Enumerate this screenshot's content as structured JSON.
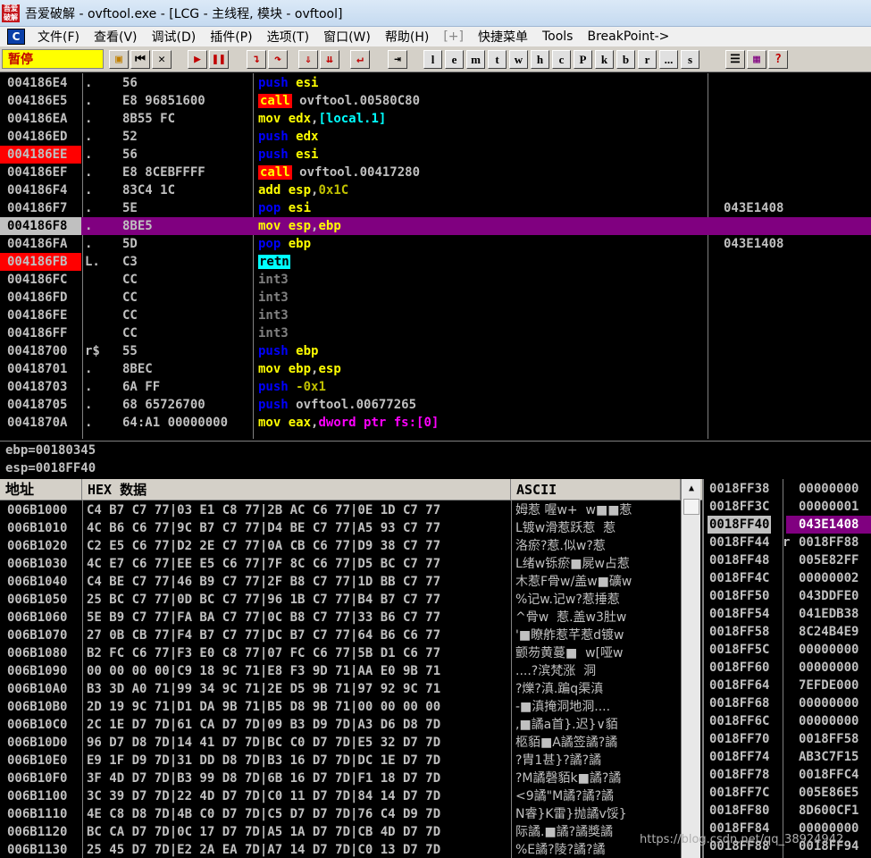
{
  "window": {
    "app_icon_text": "吾爱破解",
    "title": "吾爱破解 - ovftool.exe - [LCG - 主线程, 模块 - ovftool]"
  },
  "menu": {
    "logo": "C",
    "items": [
      "文件(F)",
      "查看(V)",
      "调试(D)",
      "插件(P)",
      "选项(T)",
      "窗口(W)",
      "帮助(H)",
      "[+]",
      "快捷菜单",
      "Tools",
      "BreakPoint->"
    ]
  },
  "toolbar": {
    "status": "暂停",
    "letters": [
      "l",
      "e",
      "m",
      "t",
      "w",
      "h",
      "c",
      "P",
      "k",
      "b",
      "r",
      "...",
      "s"
    ]
  },
  "disasm": {
    "rows": [
      {
        "addr": "004186E4",
        "br": ".",
        "hex": "56",
        "kw": "push",
        "kwc": "k-blue",
        "ops": [
          {
            "t": "esi",
            "c": "op-yellow"
          }
        ],
        "cmt": "",
        "bp": false,
        "sel": false,
        "hl": false
      },
      {
        "addr": "004186E5",
        "br": ".",
        "hex": "E8 96851600",
        "kw": "call",
        "kwc": "k-call",
        "ops": [
          {
            "t": "ovftool.00580C80",
            "c": ""
          }
        ],
        "cmt": "",
        "bp": false,
        "sel": false,
        "hl": false
      },
      {
        "addr": "004186EA",
        "br": ".",
        "hex": "8B55 FC",
        "kw": "mov",
        "kwc": "k-yellow",
        "ops": [
          {
            "t": "edx",
            "c": "op-yellow"
          },
          {
            "t": ",",
            "c": ""
          },
          {
            "t": "[local.1]",
            "c": "op-cyan"
          }
        ],
        "cmt": "",
        "bp": false,
        "sel": false,
        "hl": false
      },
      {
        "addr": "004186ED",
        "br": ".",
        "hex": "52",
        "kw": "push",
        "kwc": "k-blue",
        "ops": [
          {
            "t": "edx",
            "c": "op-yellow"
          }
        ],
        "cmt": "",
        "bp": false,
        "sel": false,
        "hl": false
      },
      {
        "addr": "004186EE",
        "br": ".",
        "hex": "56",
        "kw": "push",
        "kwc": "k-blue",
        "ops": [
          {
            "t": "esi",
            "c": "op-yellow"
          }
        ],
        "cmt": "",
        "bp": true,
        "sel": false,
        "hl": false
      },
      {
        "addr": "004186EF",
        "br": ".",
        "hex": "E8 8CEBFFFF",
        "kw": "call",
        "kwc": "k-call",
        "ops": [
          {
            "t": "ovftool.00417280",
            "c": ""
          }
        ],
        "cmt": "",
        "bp": false,
        "sel": false,
        "hl": false
      },
      {
        "addr": "004186F4",
        "br": ".",
        "hex": "83C4 1C",
        "kw": "add",
        "kwc": "k-yellow",
        "ops": [
          {
            "t": "esp",
            "c": "op-yellow"
          },
          {
            "t": ",",
            "c": ""
          },
          {
            "t": "0x1C",
            "c": "op-olive"
          }
        ],
        "cmt": "",
        "bp": false,
        "sel": false,
        "hl": false
      },
      {
        "addr": "004186F7",
        "br": ".",
        "hex": "5E",
        "kw": "pop",
        "kwc": "k-blue",
        "ops": [
          {
            "t": "esi",
            "c": "op-yellow"
          }
        ],
        "cmt": "043E1408",
        "bp": false,
        "sel": false,
        "hl": false
      },
      {
        "addr": "004186F8",
        "br": ".",
        "hex": "8BE5",
        "kw": "mov",
        "kwc": "k-yellow",
        "ops": [
          {
            "t": "esp",
            "c": "op-yellow"
          },
          {
            "t": ",",
            "c": ""
          },
          {
            "t": "ebp",
            "c": "op-yellow"
          }
        ],
        "cmt": "",
        "bp": false,
        "sel": true,
        "hl": true
      },
      {
        "addr": "004186FA",
        "br": ".",
        "hex": "5D",
        "kw": "pop",
        "kwc": "k-blue",
        "ops": [
          {
            "t": "ebp",
            "c": "op-yellow"
          }
        ],
        "cmt": "043E1408",
        "bp": false,
        "sel": false,
        "hl": false
      },
      {
        "addr": "004186FB",
        "br": "L.",
        "hex": "C3",
        "kw": "retn",
        "kwc": "k-ret",
        "ops": [],
        "cmt": "",
        "bp": true,
        "sel": false,
        "hl": false
      },
      {
        "addr": "004186FC",
        "br": "",
        "hex": "CC",
        "kw": "int3",
        "kwc": "k-grey",
        "ops": [],
        "cmt": "",
        "bp": false,
        "sel": false,
        "hl": false
      },
      {
        "addr": "004186FD",
        "br": "",
        "hex": "CC",
        "kw": "int3",
        "kwc": "k-grey",
        "ops": [],
        "cmt": "",
        "bp": false,
        "sel": false,
        "hl": false
      },
      {
        "addr": "004186FE",
        "br": "",
        "hex": "CC",
        "kw": "int3",
        "kwc": "k-grey",
        "ops": [],
        "cmt": "",
        "bp": false,
        "sel": false,
        "hl": false
      },
      {
        "addr": "004186FF",
        "br": "",
        "hex": "CC",
        "kw": "int3",
        "kwc": "k-grey",
        "ops": [],
        "cmt": "",
        "bp": false,
        "sel": false,
        "hl": false
      },
      {
        "addr": "00418700",
        "br": "r$",
        "hex": "55",
        "kw": "push",
        "kwc": "k-blue",
        "ops": [
          {
            "t": "ebp",
            "c": "op-yellow"
          }
        ],
        "cmt": "",
        "bp": false,
        "sel": false,
        "hl": false
      },
      {
        "addr": "00418701",
        "br": ".",
        "hex": "8BEC",
        "kw": "mov",
        "kwc": "k-yellow",
        "ops": [
          {
            "t": "ebp",
            "c": "op-yellow"
          },
          {
            "t": ",",
            "c": ""
          },
          {
            "t": "esp",
            "c": "op-yellow"
          }
        ],
        "cmt": "",
        "bp": false,
        "sel": false,
        "hl": false
      },
      {
        "addr": "00418703",
        "br": ".",
        "hex": "6A FF",
        "kw": "push",
        "kwc": "k-blue",
        "ops": [
          {
            "t": "-0x1",
            "c": "op-olive"
          }
        ],
        "cmt": "",
        "bp": false,
        "sel": false,
        "hl": false
      },
      {
        "addr": "00418705",
        "br": ".",
        "hex": "68 65726700",
        "kw": "push",
        "kwc": "k-blue",
        "ops": [
          {
            "t": "ovftool.00677265",
            "c": ""
          }
        ],
        "cmt": "",
        "bp": false,
        "sel": false,
        "hl": false
      },
      {
        "addr": "0041870A",
        "br": ".",
        "hex": "64:A1 00000000",
        "kw": "mov",
        "kwc": "k-yellow",
        "ops": [
          {
            "t": "eax",
            "c": "op-yellow"
          },
          {
            "t": ",",
            "c": ""
          },
          {
            "t": "dword ptr fs:[0]",
            "c": "op-mag"
          }
        ],
        "cmt": "",
        "bp": false,
        "sel": false,
        "hl": false
      }
    ]
  },
  "info": {
    "line1": "ebp=00180345",
    "line2": "esp=0018FF40"
  },
  "dump": {
    "header_addr": "地址",
    "header_hex": "HEX 数据",
    "header_ascii": "ASCII",
    "rows": [
      {
        "addr": "006B1000",
        "hex": "C4 B7 C7 77|03 E1 C8 77|2B AC C6 77|0E 1D C7 77",
        "asc": "姆惹 喔w+  w■■惹"
      },
      {
        "addr": "006B1010",
        "hex": "4C B6 C6 77|9C B7 C7 77|D4 BE C7 77|A5 93 C7 77",
        "asc": "L镀w滑惹跃惹  惹"
      },
      {
        "addr": "006B1020",
        "hex": "C2 E5 C6 77|D2 2E C7 77|0A CB C6 77|D9 38 C7 77",
        "asc": "洛瘀?惹.似w?惹"
      },
      {
        "addr": "006B1030",
        "hex": "4C E7 C6 77|EE E5 C6 77|7F 8C C6 77|D5 BC C7 77",
        "asc": "L绪w铄瘀■屍w占惹"
      },
      {
        "addr": "006B1040",
        "hex": "C4 BE C7 77|46 B9 C7 77|2F B8 C7 77|1D BB C7 77",
        "asc": "木惹F骨w/盖w■礦w"
      },
      {
        "addr": "006B1050",
        "hex": "25 BC C7 77|0D BC C7 77|96 1B C7 77|B4 B7 C7 77",
        "asc": "%记w.记w?惹捶惹"
      },
      {
        "addr": "006B1060",
        "hex": "5E B9 C7 77|FA BA C7 77|0C B8 C7 77|33 B6 C7 77",
        "asc": "^骨w  惹.盖w3肚w"
      },
      {
        "addr": "006B1070",
        "hex": "27 0B CB 77|F4 B7 C7 77|DC B7 C7 77|64 B6 C6 77",
        "asc": "'■瞭舴惹芊惹d镀w"
      },
      {
        "addr": "006B1080",
        "hex": "B2 FC C6 77|F3 E0 C8 77|07 FC C6 77|5B D1 C6 77",
        "asc": "颤芴黄蔓■  w[哑w"
      },
      {
        "addr": "006B1090",
        "hex": "00 00 00 00|C9 18 9C 71|E8 F3 9D 71|AA E0 9B 71",
        "asc": "....?滨梵涨  洞"
      },
      {
        "addr": "006B10A0",
        "hex": "B3 3D A0 71|99 34 9C 71|2E D5 9B 71|97 92 9C 71",
        "asc": "?爍?滇.蹁q渠滇"
      },
      {
        "addr": "006B10B0",
        "hex": "2D 19 9C 71|D1 DA 9B 71|B5 D8 9B 71|00 00 00 00",
        "asc": "-■滇掩洞地洞...."
      },
      {
        "addr": "006B10C0",
        "hex": "2C 1E D7 7D|61 CA D7 7D|09 B3 D9 7D|A3 D6 D8 7D",
        "asc": ",■譎a首}.迟}∨貊"
      },
      {
        "addr": "006B10D0",
        "hex": "96 D7 D8 7D|14 41 D7 7D|BC C0 D7 7D|E5 32 D7 7D",
        "asc": "柩貊■A譎签譎?譎"
      },
      {
        "addr": "006B10E0",
        "hex": "E9 1F D9 7D|31 DD D8 7D|B3 16 D7 7D|DC 1E D7 7D",
        "asc": "?胄1甚}?譎?譎"
      },
      {
        "addr": "006B10F0",
        "hex": "3F 4D D7 7D|B3 99 D8 7D|6B 16 D7 7D|F1 18 D7 7D",
        "asc": "?M譎磬貊k■譎?譎"
      },
      {
        "addr": "006B1100",
        "hex": "3C 39 D7 7D|22 4D D7 7D|C0 11 D7 7D|84 14 D7 7D",
        "asc": "<9譎\"M譎?譎?譎"
      },
      {
        "addr": "006B1110",
        "hex": "4E C8 D8 7D|4B C0 D7 7D|C5 D7 D7 7D|76 C4 D9 7D",
        "asc": "N睿}K雷}抛譎v馁}"
      },
      {
        "addr": "006B1120",
        "hex": "BC CA D7 7D|0C 17 D7 7D|A5 1A D7 7D|CB 4D D7 7D",
        "asc": "际譎.■譎?譎獎譎"
      },
      {
        "addr": "006B1130",
        "hex": "25 45 D7 7D|E2 2A EA 7D|A7 14 D7 7D|C0 13 D7 7D",
        "asc": "%E譎?陵?譎?譎"
      }
    ]
  },
  "stack": {
    "rows": [
      {
        "addr": "0018FF38",
        "br": "",
        "val": "00000000",
        "sel": false
      },
      {
        "addr": "0018FF3C",
        "br": "",
        "val": "00000001",
        "sel": false
      },
      {
        "addr": "0018FF40",
        "br": "",
        "val": "043E1408",
        "sel": true
      },
      {
        "addr": "0018FF44",
        "br": "r",
        "val": "0018FF88",
        "sel": false
      },
      {
        "addr": "0018FF48",
        "br": "",
        "val": "005E82FF",
        "sel": false
      },
      {
        "addr": "0018FF4C",
        "br": "",
        "val": "00000002",
        "sel": false
      },
      {
        "addr": "0018FF50",
        "br": "",
        "val": "043DDFE0",
        "sel": false
      },
      {
        "addr": "0018FF54",
        "br": "",
        "val": "041EDB38",
        "sel": false
      },
      {
        "addr": "0018FF58",
        "br": "",
        "val": "8C24B4E9",
        "sel": false
      },
      {
        "addr": "0018FF5C",
        "br": "",
        "val": "00000000",
        "sel": false
      },
      {
        "addr": "0018FF60",
        "br": "",
        "val": "00000000",
        "sel": false
      },
      {
        "addr": "0018FF64",
        "br": "",
        "val": "7EFDE000",
        "sel": false
      },
      {
        "addr": "0018FF68",
        "br": "",
        "val": "00000000",
        "sel": false
      },
      {
        "addr": "0018FF6C",
        "br": "",
        "val": "00000000",
        "sel": false
      },
      {
        "addr": "0018FF70",
        "br": "",
        "val": "0018FF58",
        "sel": false
      },
      {
        "addr": "0018FF74",
        "br": "",
        "val": "AB3C7F15",
        "sel": false
      },
      {
        "addr": "0018FF78",
        "br": "",
        "val": "0018FFC4",
        "sel": false
      },
      {
        "addr": "0018FF7C",
        "br": "",
        "val": "005E86E5",
        "sel": false
      },
      {
        "addr": "0018FF80",
        "br": "",
        "val": "8D600CF1",
        "sel": false
      },
      {
        "addr": "0018FF84",
        "br": "",
        "val": "00000000",
        "sel": false
      },
      {
        "addr": "0018FF88",
        "br": "",
        "val": "0018FF94",
        "sel": false
      }
    ]
  },
  "watermark": "https://blog.csdn.net/qq_38924942"
}
